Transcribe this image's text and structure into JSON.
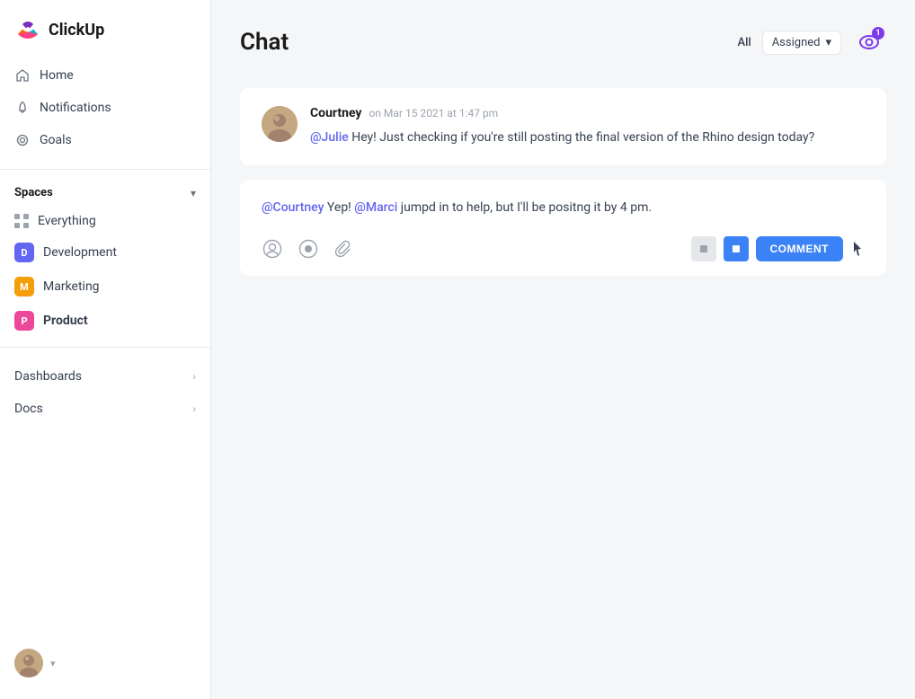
{
  "app": {
    "name": "ClickUp"
  },
  "sidebar": {
    "nav": [
      {
        "id": "home",
        "label": "Home",
        "icon": "home-icon"
      },
      {
        "id": "notifications",
        "label": "Notifications",
        "icon": "bell-icon"
      },
      {
        "id": "goals",
        "label": "Goals",
        "icon": "goals-icon"
      }
    ],
    "spaces_label": "Spaces",
    "spaces": [
      {
        "id": "everything",
        "label": "Everything",
        "type": "grid"
      },
      {
        "id": "development",
        "label": "Development",
        "type": "badge",
        "badge_letter": "D",
        "badge_class": "badge-dev"
      },
      {
        "id": "marketing",
        "label": "Marketing",
        "type": "badge",
        "badge_letter": "M",
        "badge_class": "badge-mkt"
      },
      {
        "id": "product",
        "label": "Product",
        "type": "badge",
        "badge_letter": "P",
        "badge_class": "badge-prd",
        "active": true
      }
    ],
    "sections": [
      {
        "id": "dashboards",
        "label": "Dashboards"
      },
      {
        "id": "docs",
        "label": "Docs"
      }
    ]
  },
  "main": {
    "title": "Chat",
    "filter_all": "All",
    "filter_assigned": "Assigned",
    "notification_count": "1",
    "messages": [
      {
        "id": "msg1",
        "author": "Courtney",
        "time": "on Mar 15 2021 at 1:47 pm",
        "mention": "@Julie",
        "text": " Hey! Just checking if you're still posting the final version of the Rhino design today?"
      }
    ],
    "reply": {
      "mention1": "@Courtney",
      "text1": " Yep! ",
      "mention2": "@Marci",
      "text2": " jumpd in to help, but I'll be positng it by 4 pm."
    },
    "comment_button": "COMMENT"
  }
}
